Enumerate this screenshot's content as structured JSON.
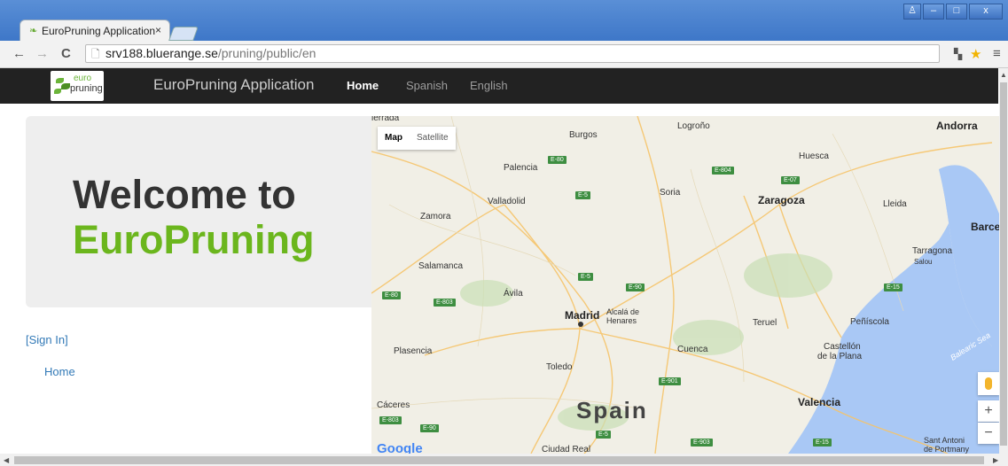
{
  "browser": {
    "tab_title": "EuroPruning Application",
    "tab_close": "×",
    "url_host": "srv188.bluerange.se",
    "url_path": "/pruning/public/en",
    "back": "←",
    "forward": "→",
    "reload": "C",
    "window_buttons": [
      "♙",
      "–",
      "□",
      "x"
    ]
  },
  "navbar": {
    "logo_line1": "euro",
    "logo_line2": "pruning",
    "brand": "EuroPruning Application",
    "links": [
      {
        "label": "Home",
        "active": true
      },
      {
        "label": "Spanish",
        "active": false
      },
      {
        "label": "English",
        "active": false
      }
    ]
  },
  "hero": {
    "line1": "Welcome to",
    "line2": "EuroPruning"
  },
  "sidebar": {
    "signin": "[Sign In]",
    "home": "Home"
  },
  "map": {
    "type_buttons": [
      "Map",
      "Satellite"
    ],
    "attribution": "Google",
    "zoom_in": "+",
    "zoom_out": "−",
    "places": [
      {
        "name": "Burgos",
        "cls": ""
      },
      {
        "name": "Logroño",
        "cls": ""
      },
      {
        "name": "Andorra",
        "cls": "big"
      },
      {
        "name": "Huesca",
        "cls": ""
      },
      {
        "name": "Palencia",
        "cls": ""
      },
      {
        "name": "Soria",
        "cls": ""
      },
      {
        "name": "Zaragoza",
        "cls": "big"
      },
      {
        "name": "Valladolid",
        "cls": ""
      },
      {
        "name": "Lleida",
        "cls": ""
      },
      {
        "name": "Zamora",
        "cls": ""
      },
      {
        "name": "Barce",
        "cls": "big"
      },
      {
        "name": "Tarragona",
        "cls": ""
      },
      {
        "name": "Salou",
        "cls": ""
      },
      {
        "name": "Salamanca",
        "cls": ""
      },
      {
        "name": "Ávila",
        "cls": ""
      },
      {
        "name": "Madrid",
        "cls": "big"
      },
      {
        "name": "Alcalá de",
        "cls": ""
      },
      {
        "name": "Henares",
        "cls": ""
      },
      {
        "name": "Teruel",
        "cls": ""
      },
      {
        "name": "Peñíscola",
        "cls": ""
      },
      {
        "name": "Plasencia",
        "cls": ""
      },
      {
        "name": "Cuenca",
        "cls": ""
      },
      {
        "name": "Castellón",
        "cls": ""
      },
      {
        "name": "de la Plana",
        "cls": ""
      },
      {
        "name": "Toledo",
        "cls": ""
      },
      {
        "name": "Cáceres",
        "cls": ""
      },
      {
        "name": "Spain",
        "cls": "country"
      },
      {
        "name": "Valencia",
        "cls": "big"
      },
      {
        "name": "Ciudad Real",
        "cls": ""
      },
      {
        "name": "Sant Antoni",
        "cls": ""
      },
      {
        "name": "de Portmany",
        "cls": ""
      },
      {
        "name": "Balearic Sea",
        "cls": "sea"
      },
      {
        "name": "ierrada",
        "cls": ""
      }
    ],
    "roads": [
      "E-80",
      "E-804",
      "E-07",
      "E-5",
      "E-5",
      "E-90",
      "E-15",
      "E-80",
      "E-803",
      "E-901",
      "E-803",
      "E-90",
      "E-5",
      "E-903",
      "E-15"
    ]
  },
  "colors": {
    "accent_green": "#6bb61d",
    "navbar_bg": "#222222",
    "link_blue": "#337ab7"
  }
}
